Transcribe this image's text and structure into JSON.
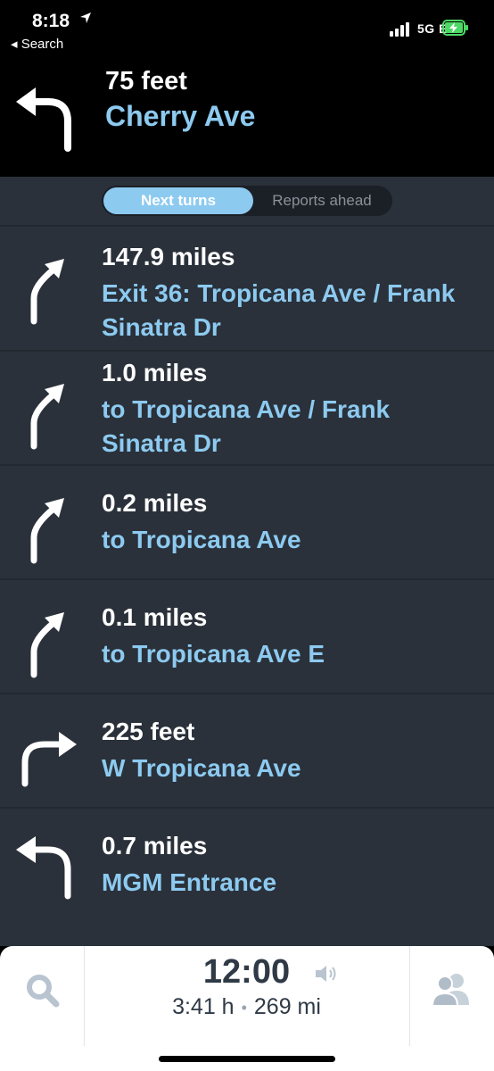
{
  "status_bar": {
    "time": "8:18",
    "back_label": "◂ Search",
    "network": "5G E"
  },
  "current": {
    "distance": "75 feet",
    "street": "Cherry Ave",
    "turn": "left"
  },
  "tabs": {
    "active": "Next turns",
    "inactive": "Reports ahead"
  },
  "turns": [
    {
      "distance": "147.9 miles",
      "street": "Exit 36: Tropicana Ave / Frank Sinatra Dr",
      "turn": "slight-right"
    },
    {
      "distance": "1.0 miles",
      "street": "to Tropicana Ave / Frank Sinatra Dr",
      "turn": "slight-right"
    },
    {
      "distance": "0.2 miles",
      "street": "to Tropicana Ave",
      "turn": "slight-right"
    },
    {
      "distance": "0.1 miles",
      "street": "to Tropicana Ave E",
      "turn": "slight-right"
    },
    {
      "distance": "225 feet",
      "street": "W Tropicana Ave",
      "turn": "right"
    },
    {
      "distance": "0.7 miles",
      "street": "MGM Entrance",
      "turn": "left"
    }
  ],
  "bottom": {
    "eta": "12:00",
    "duration": "3:41 h",
    "separator": "•",
    "distance": "269 mi"
  },
  "colors": {
    "accent": "#8dcaf0",
    "list_bg": "#2a313a",
    "header_bg": "#000000"
  }
}
